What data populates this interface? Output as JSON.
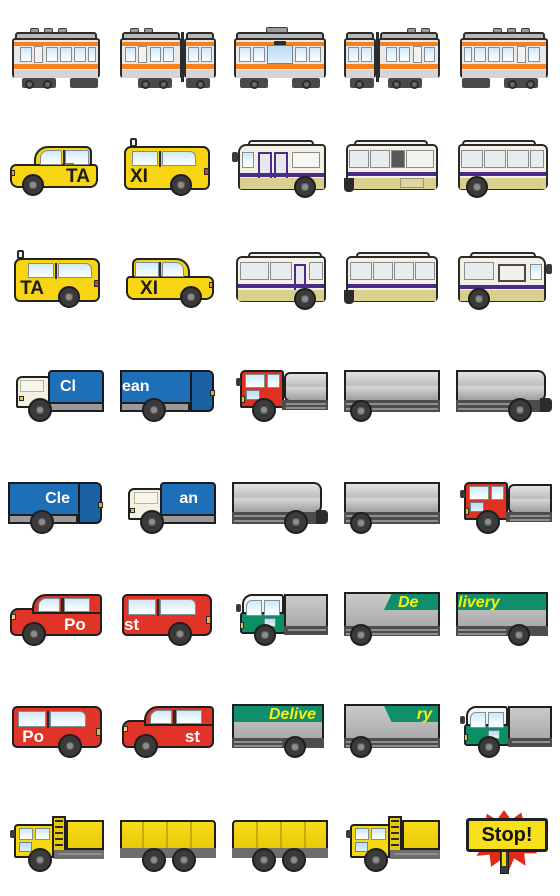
{
  "sheet": {
    "title": "Vehicle Emoji Sticker Sheet",
    "columns": 5,
    "rows": 8,
    "background_color": "#ffffff",
    "cell_size_px": 112
  },
  "palette": {
    "train_stripe": "#f58220",
    "train_body": "#e9e9e9",
    "taxi_yellow": "#f7d512",
    "bus_cream": "#f4f1e4",
    "bus_purple": "#4a2b8c",
    "bus_skirt": "#d9cf8e",
    "clean_blue": "#1d6fb8",
    "tanker_silver": "#bdbdbd",
    "tanker_cab_red": "#e03020",
    "post_red": "#e03428",
    "delivery_green": "#0f8f6b",
    "delivery_yellow_text": "#f5f112",
    "dump_yellow": "#f5d80d",
    "stop_yellow": "#f7e01a",
    "stop_burst_red": "#e02a18",
    "outline": "#1f1f1f"
  },
  "rows": [
    {
      "name": "commuter-train-orange-line",
      "label": "Commuter train (orange line)",
      "cells": [
        {
          "name": "train-car-rear",
          "label": "Train car rear",
          "text": ""
        },
        {
          "name": "train-car-coupled",
          "label": "Train cars coupled",
          "text": ""
        },
        {
          "name": "train-car-middle",
          "label": "Train car middle",
          "text": ""
        },
        {
          "name": "train-car-coupled-2",
          "label": "Train cars coupled 2",
          "text": ""
        },
        {
          "name": "train-car-front",
          "label": "Train car front",
          "text": ""
        }
      ]
    },
    {
      "name": "taxi-and-bus-front",
      "label": "Taxi and bus (facing right)",
      "cells": [
        {
          "name": "taxi-sedan-front-half",
          "label": "Taxi sedan front half",
          "text": "TA"
        },
        {
          "name": "taxi-van-rear-half",
          "label": "Taxi van rear half",
          "text": "XI"
        },
        {
          "name": "bus-front",
          "label": "Bus front",
          "text": ""
        },
        {
          "name": "bus-middle",
          "label": "Bus middle",
          "text": ""
        },
        {
          "name": "bus-rear",
          "label": "Bus rear",
          "text": ""
        }
      ]
    },
    {
      "name": "taxi-and-bus-mirrored",
      "label": "Taxi and bus (facing left)",
      "cells": [
        {
          "name": "taxi-van-rear-half-left",
          "label": "Taxi van rear half left",
          "text": "TA"
        },
        {
          "name": "taxi-sedan-front-half-left",
          "label": "Taxi sedan front half left",
          "text": "XI"
        },
        {
          "name": "bus-rear-left",
          "label": "Bus rear left",
          "text": ""
        },
        {
          "name": "bus-middle-left",
          "label": "Bus middle left",
          "text": ""
        },
        {
          "name": "bus-front-left",
          "label": "Bus front left",
          "text": ""
        }
      ]
    },
    {
      "name": "garbage-truck-and-tanker",
      "label": "Garbage truck and tanker (facing right)",
      "cells": [
        {
          "name": "garbage-truck-cab-right",
          "label": "Garbage truck cab",
          "text": "Cl"
        },
        {
          "name": "garbage-truck-body-right",
          "label": "Garbage truck body",
          "text": "ean"
        },
        {
          "name": "tanker-cab-red-right",
          "label": "Tanker red cab",
          "text": ""
        },
        {
          "name": "tanker-tank-middle",
          "label": "Tanker tank middle",
          "text": ""
        },
        {
          "name": "tanker-tank-rear",
          "label": "Tanker tank rear",
          "text": ""
        }
      ]
    },
    {
      "name": "garbage-truck-and-tanker-mirrored",
      "label": "Garbage truck and tanker (facing left)",
      "cells": [
        {
          "name": "garbage-truck-body-left",
          "label": "Garbage truck body left",
          "text": "Cle"
        },
        {
          "name": "garbage-truck-cab-left",
          "label": "Garbage truck cab left",
          "text": "an"
        },
        {
          "name": "tanker-tank-rear-left",
          "label": "Tanker tank rear left",
          "text": ""
        },
        {
          "name": "tanker-tank-middle-left",
          "label": "Tanker tank middle left",
          "text": ""
        },
        {
          "name": "tanker-cab-red-left",
          "label": "Tanker red cab left",
          "text": ""
        }
      ]
    },
    {
      "name": "post-van-and-delivery-truck",
      "label": "Post van and delivery truck (facing right)",
      "cells": [
        {
          "name": "post-van-front-right",
          "label": "Post van front",
          "text": "Po"
        },
        {
          "name": "post-van-rear-right",
          "label": "Post van rear",
          "text": "st"
        },
        {
          "name": "delivery-truck-cab-right",
          "label": "Delivery truck cab",
          "text": ""
        },
        {
          "name": "delivery-truck-body-right",
          "label": "Delivery truck body",
          "text": "De"
        },
        {
          "name": "delivery-truck-rear-right",
          "label": "Delivery truck rear",
          "text": "livery"
        }
      ]
    },
    {
      "name": "post-van-and-delivery-truck-mirrored",
      "label": "Post van and delivery truck (facing left)",
      "cells": [
        {
          "name": "post-van-rear-left",
          "label": "Post van rear left",
          "text": "Po"
        },
        {
          "name": "post-van-front-left",
          "label": "Post van front left",
          "text": "st"
        },
        {
          "name": "delivery-truck-rear-left",
          "label": "Delivery truck rear left",
          "text": "Delive"
        },
        {
          "name": "delivery-truck-body-left",
          "label": "Delivery truck body left",
          "text": "ry"
        },
        {
          "name": "delivery-truck-cab-left",
          "label": "Delivery truck cab left",
          "text": ""
        }
      ]
    },
    {
      "name": "dump-truck-and-stop-sign",
      "label": "Dump truck and stop sign",
      "cells": [
        {
          "name": "dump-truck-cab-right",
          "label": "Dump truck cab",
          "text": ""
        },
        {
          "name": "dump-truck-bed-right",
          "label": "Dump truck bed",
          "text": ""
        },
        {
          "name": "dump-truck-bed-left",
          "label": "Dump truck bed left",
          "text": ""
        },
        {
          "name": "dump-truck-cab-left",
          "label": "Dump truck cab left",
          "text": ""
        },
        {
          "name": "stop-sign",
          "label": "Stop sign",
          "text": "Stop!"
        }
      ]
    }
  ]
}
